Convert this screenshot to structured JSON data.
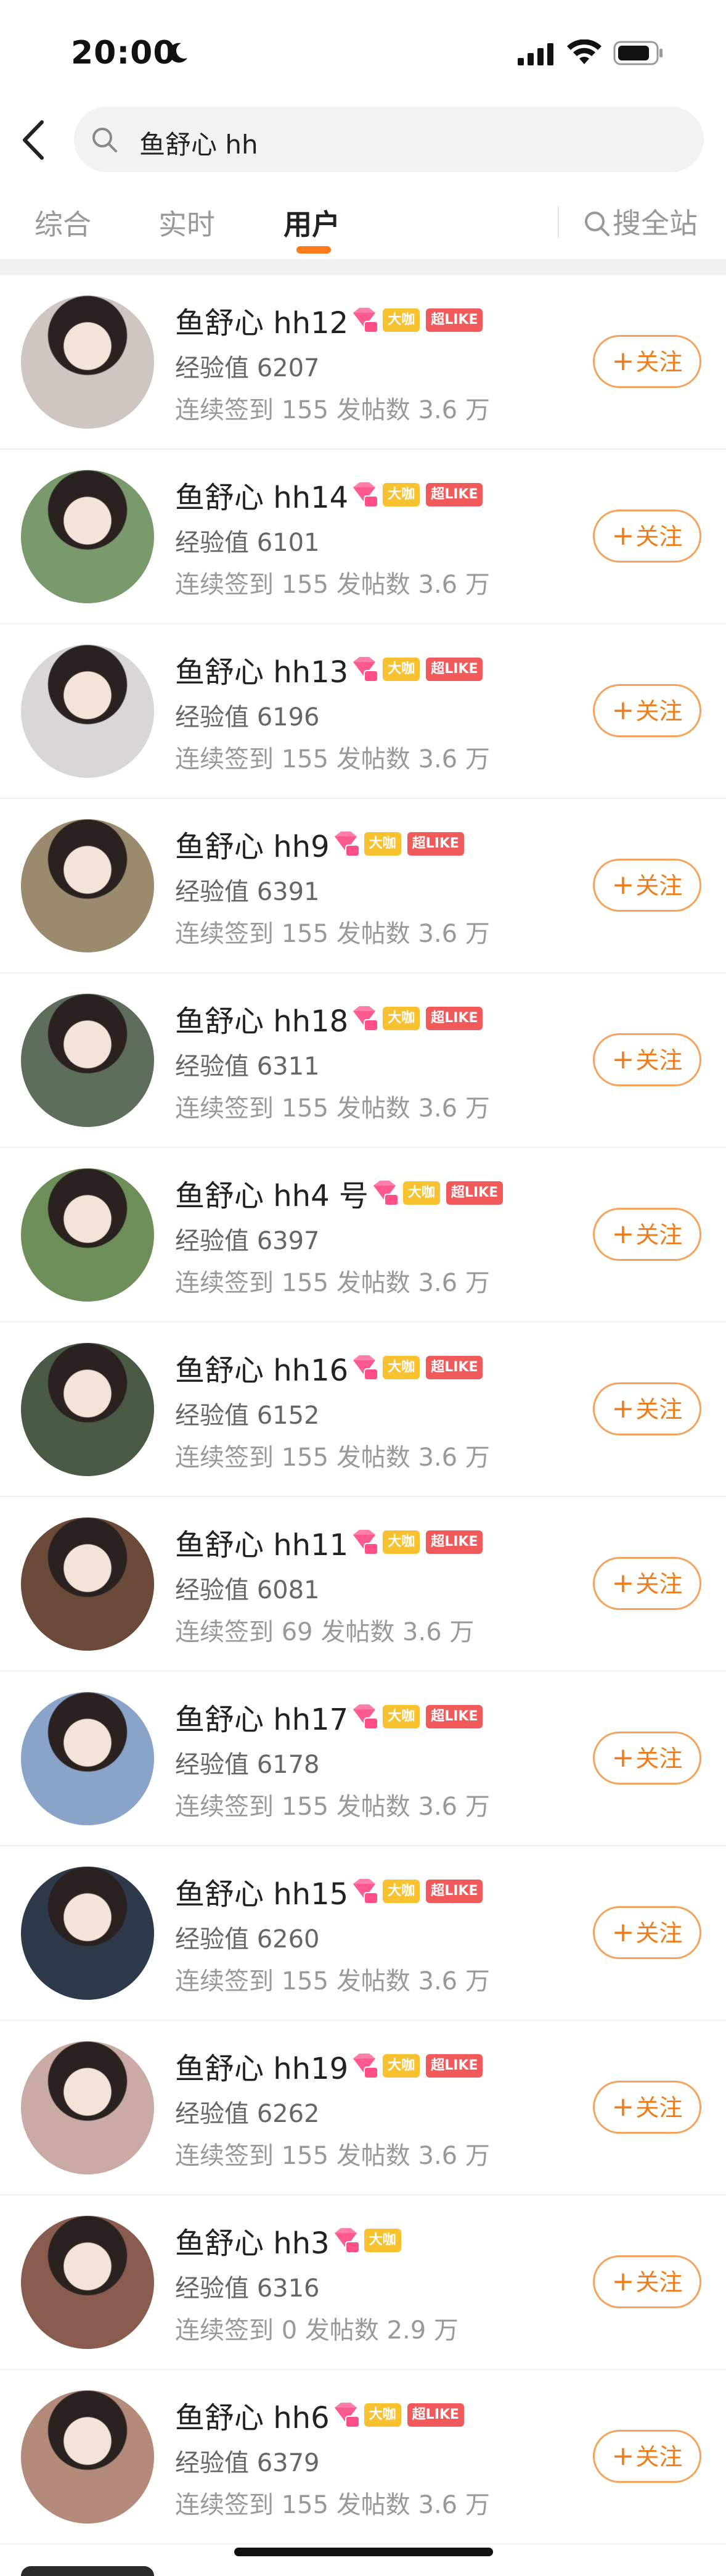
{
  "status_bar": {
    "time": "20:00"
  },
  "search": {
    "query": "鱼舒心 hh"
  },
  "tabs": [
    {
      "label": "综合",
      "active": false
    },
    {
      "label": "实时",
      "active": false
    },
    {
      "label": "用户",
      "active": true
    }
  ],
  "site_search_label": "搜全站",
  "colors": {
    "accent": "#ff7a1a",
    "badge_da": "#f8c12f",
    "badge_like": "#f15a5a",
    "follow_border": "#f5a25d"
  },
  "badges": {
    "da": "大咖",
    "like": "超LIKE"
  },
  "follow_label": "关注",
  "users": [
    {
      "name": "鱼舒心 hh12",
      "exp": "经验值 6207",
      "stats": "连续签到 155 发帖数 3.6 万",
      "has_like": true,
      "avatar_color": "#cfc6c2"
    },
    {
      "name": "鱼舒心 hh14",
      "exp": "经验值 6101",
      "stats": "连续签到 155 发帖数 3.6 万",
      "has_like": true,
      "avatar_color": "#7a9a6e"
    },
    {
      "name": "鱼舒心 hh13",
      "exp": "经验值 6196",
      "stats": "连续签到 155 发帖数 3.6 万",
      "has_like": true,
      "avatar_color": "#d9d6d8"
    },
    {
      "name": "鱼舒心 hh9",
      "exp": "经验值 6391",
      "stats": "连续签到 155 发帖数 3.6 万",
      "has_like": true,
      "avatar_color": "#9a8b6f"
    },
    {
      "name": "鱼舒心 hh18",
      "exp": "经验值 6311",
      "stats": "连续签到 155 发帖数 3.6 万",
      "has_like": true,
      "avatar_color": "#5f6d5c"
    },
    {
      "name": "鱼舒心 hh4 号",
      "exp": "经验值 6397",
      "stats": "连续签到 155 发帖数 3.6 万",
      "has_like": true,
      "avatar_color": "#6f8f5a"
    },
    {
      "name": "鱼舒心 hh16",
      "exp": "经验值 6152",
      "stats": "连续签到 155 发帖数 3.6 万",
      "has_like": true,
      "avatar_color": "#4a5a45"
    },
    {
      "name": "鱼舒心 hh11",
      "exp": "经验值 6081",
      "stats": "连续签到 69 发帖数 3.6 万",
      "has_like": true,
      "avatar_color": "#6b4a3a"
    },
    {
      "name": "鱼舒心 hh17",
      "exp": "经验值 6178",
      "stats": "连续签到 155 发帖数 3.6 万",
      "has_like": true,
      "avatar_color": "#8aa3c8"
    },
    {
      "name": "鱼舒心 hh15",
      "exp": "经验值 6260",
      "stats": "连续签到 155 发帖数 3.6 万",
      "has_like": true,
      "avatar_color": "#2e3a4a"
    },
    {
      "name": "鱼舒心 hh19",
      "exp": "经验值 6262",
      "stats": "连续签到 155 发帖数 3.6 万",
      "has_like": true,
      "avatar_color": "#c9aaa5"
    },
    {
      "name": "鱼舒心 hh3",
      "exp": "经验值 6316",
      "stats": "连续签到 0 发帖数 2.9 万",
      "has_like": false,
      "avatar_color": "#8a5c50"
    },
    {
      "name": "鱼舒心 hh6",
      "exp": "经验值 6379",
      "stats": "连续签到 155 发帖数 3.6 万",
      "has_like": true,
      "avatar_color": "#b48a7a"
    }
  ]
}
